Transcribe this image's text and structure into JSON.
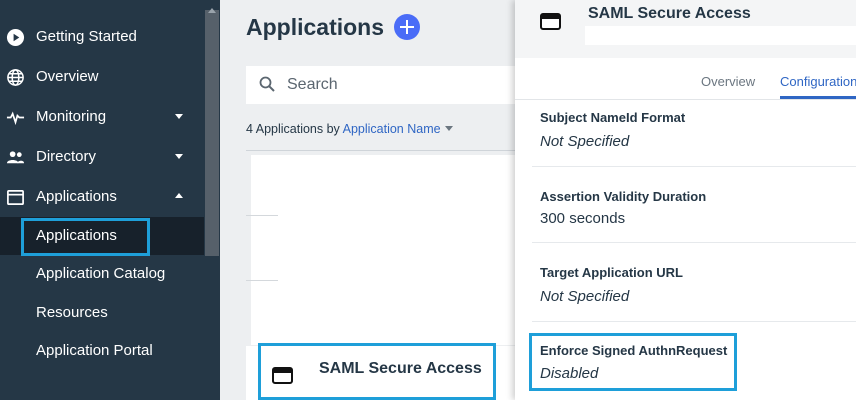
{
  "sidebar": {
    "items": [
      {
        "label": "Getting Started",
        "icon": "play-circle-icon"
      },
      {
        "label": "Overview",
        "icon": "globe-icon"
      },
      {
        "label": "Monitoring",
        "icon": "pulse-icon"
      },
      {
        "label": "Directory",
        "icon": "users-icon"
      },
      {
        "label": "Applications",
        "icon": "window-icon"
      }
    ],
    "sub_items": [
      {
        "label": "Applications"
      },
      {
        "label": "Application Catalog"
      },
      {
        "label": "Resources"
      },
      {
        "label": "Application Portal"
      }
    ]
  },
  "main": {
    "title": "Applications",
    "search_placeholder": "Search",
    "count_text": "4 Applications by ",
    "sort_label": "Application Name",
    "highlighted_row_name": "SAML Secure Access"
  },
  "panel": {
    "title": "SAML Secure Access",
    "tabs": [
      {
        "label": "Overview"
      },
      {
        "label": "Configuration"
      }
    ],
    "fields": [
      {
        "label": "Subject NameId Format",
        "value": "Not Specified"
      },
      {
        "label": "Assertion Validity Duration",
        "value": "300 seconds"
      },
      {
        "label": "Target Application URL",
        "value": "Not Specified"
      },
      {
        "label": "Enforce Signed AuthnRequest",
        "value": "Disabled"
      }
    ]
  },
  "colors": {
    "sidebar_bg": "#253746",
    "accent": "#2f66c4",
    "add_button": "#4a6cf7",
    "highlight_border": "#1e9fd9"
  }
}
